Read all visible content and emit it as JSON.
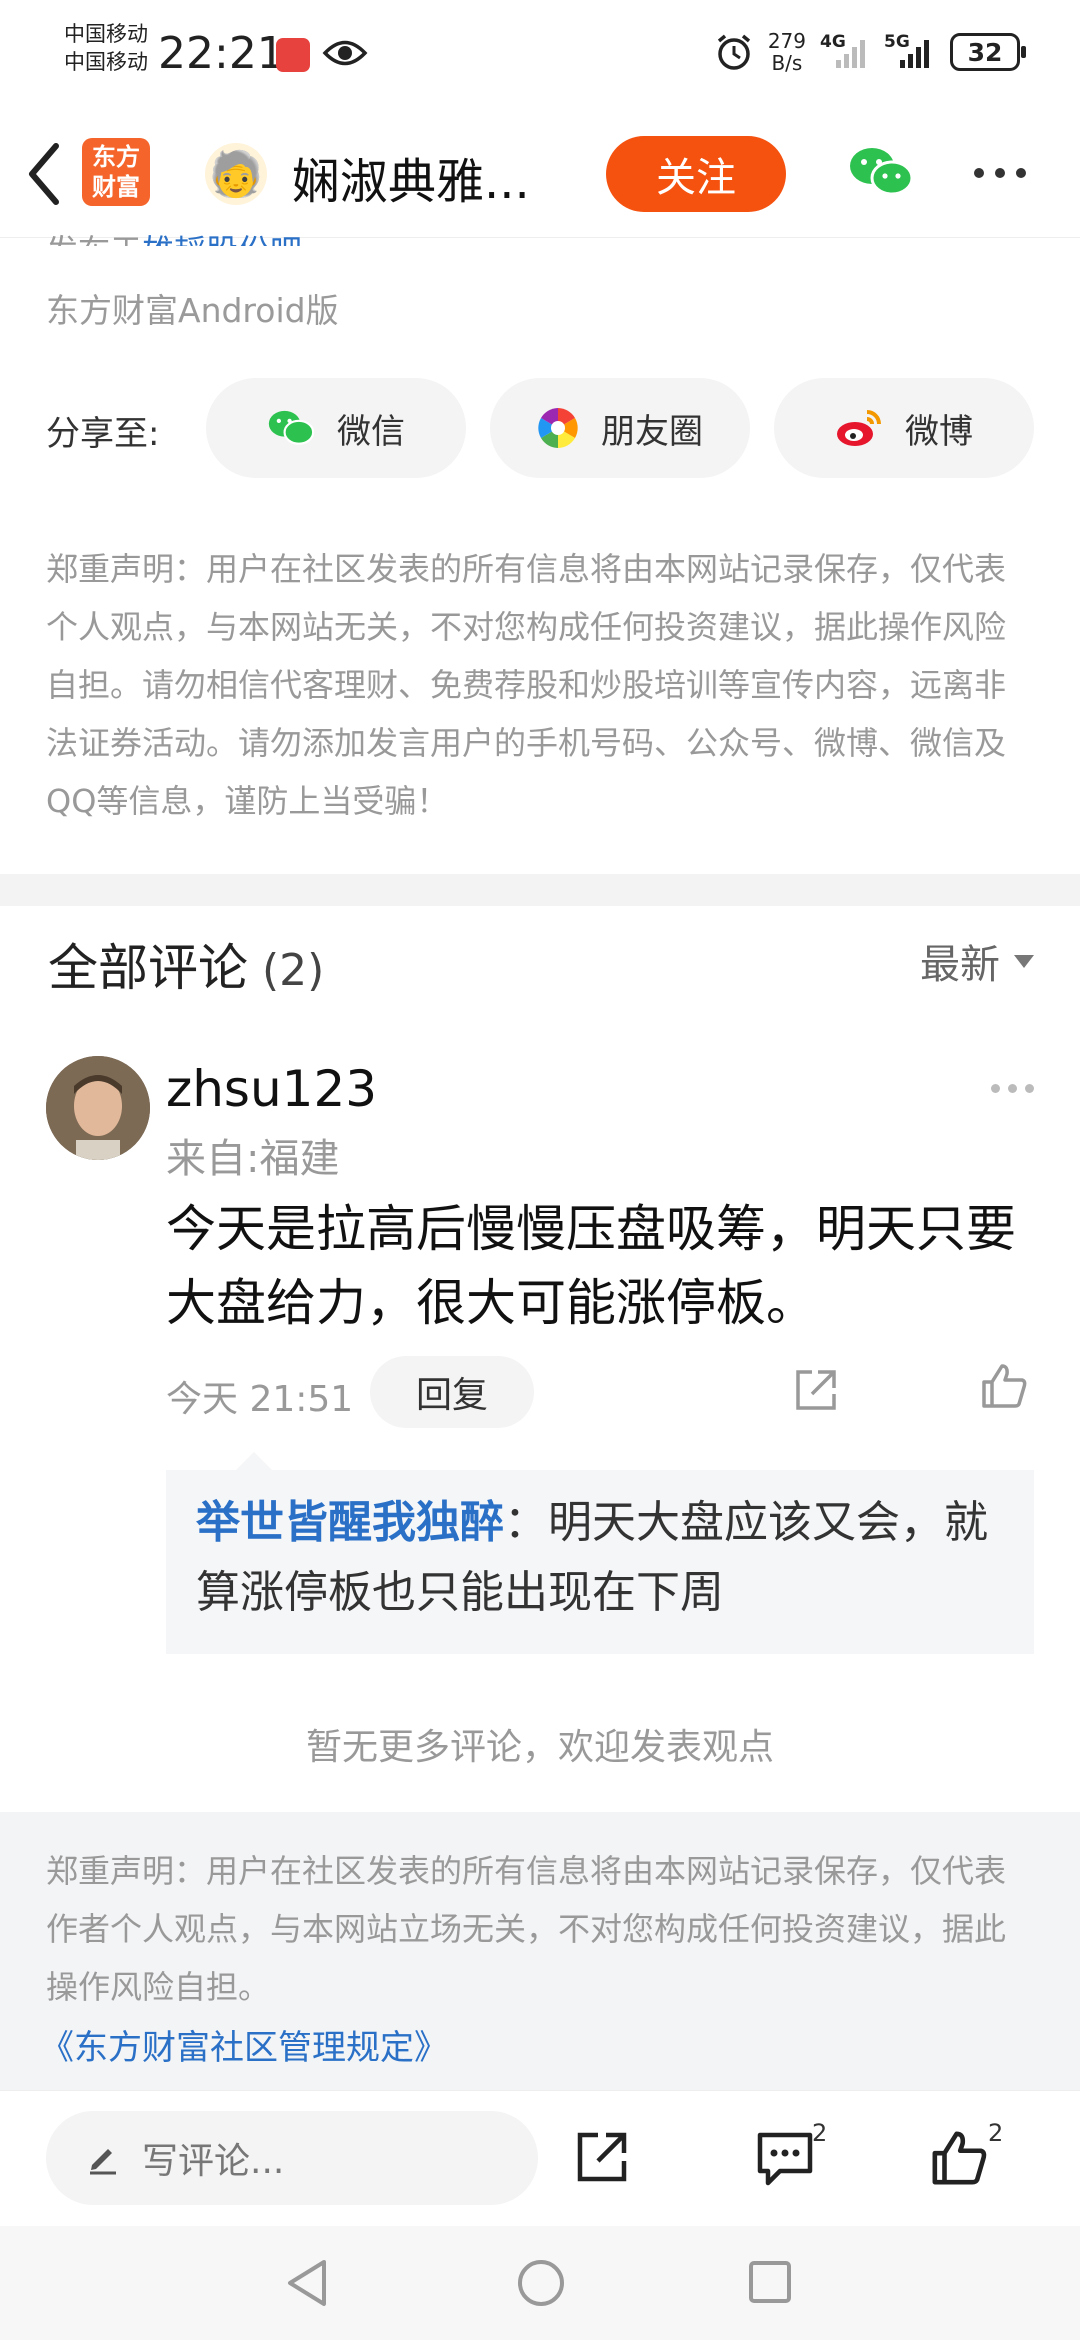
{
  "status_bar": {
    "carrier_1": "中国移动",
    "carrier_2": "中国移动",
    "time": "22:21",
    "net_speed_value": "279",
    "net_speed_unit": "B/s",
    "signal_1": "4G",
    "signal_2": "5G",
    "battery": "32"
  },
  "nav": {
    "logo_line1": "东方",
    "logo_line2": "财富",
    "avatar_emoji": "🧓",
    "title": "娴淑典雅...",
    "follow_label": "关注"
  },
  "article": {
    "published_prefix": "发布于",
    "published_bar": "雄韬股份吧",
    "source": "东方财富Android版",
    "share_label": "分享至:",
    "share_wechat": "微信",
    "share_moments": "朋友圈",
    "share_weibo": "微博",
    "notice": "郑重声明：用户在社区发表的所有信息将由本网站记录保存，仅代表个人观点，与本网站无关，不对您构成任何投资建议，据此操作风险自担。请勿相信代客理财、免费荐股和炒股培训等宣传内容，远离非法证券活动。请勿添加发言用户的手机号码、公众号、微博、微信及QQ等信息，谨防上当受骗！"
  },
  "comments": {
    "header": "全部评论",
    "count": "(2)",
    "sort_label": "最新",
    "items": [
      {
        "user": "zhsu123",
        "from": "来自:福建",
        "text": "今天是拉高后慢慢压盘吸筹，明天只要大盘给力，很大可能涨停板。",
        "time": "今天 21:51",
        "reply_label": "回复",
        "reply": {
          "user": "举世皆醒我独醉",
          "separator": "：",
          "text": "明天大盘应该又会，就算涨停板也只能出现在下周"
        }
      }
    ],
    "no_more": "暂无更多评论，欢迎发表观点"
  },
  "footer": {
    "notice": "郑重声明：用户在社区发表的所有信息将由本网站记录保存，仅代表作者个人观点，与本网站立场无关，不对您构成任何投资建议，据此操作风险自担。",
    "rules_link": "《东方财富社区管理规定》"
  },
  "bottom_bar": {
    "write_placeholder": "写评论...",
    "comment_count": "2",
    "like_count": "2"
  },
  "colors": {
    "accent_orange": "#f5520f",
    "link_blue": "#2a70c7"
  }
}
